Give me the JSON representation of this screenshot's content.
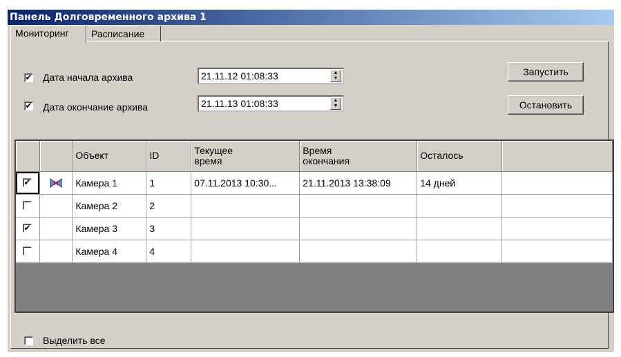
{
  "window": {
    "title": "Панель Долговременного архива 1"
  },
  "tabs": [
    {
      "label": "Мониторинг",
      "active": true
    },
    {
      "label": "Расписание",
      "active": false
    }
  ],
  "archive_start": {
    "label": "Дата начала архива",
    "checked": true,
    "value": "21.11.12 01:08:33"
  },
  "archive_end": {
    "label": "Дата окончание архива",
    "checked": true,
    "value": "21.11.13 01:08:33"
  },
  "buttons": {
    "start": "Запустить",
    "stop": "Остановить"
  },
  "table": {
    "columns": [
      "",
      "",
      "Объект",
      "ID",
      "Текущее время",
      "Время окончания",
      "Осталось",
      ""
    ],
    "rows": [
      {
        "checked": true,
        "icon": "camera-recording-icon",
        "object": "Камера 1",
        "id": "1",
        "current_time": "07.11.2013 10:30...",
        "end_time": "21.11.2013 13:38:09",
        "remaining": "14 дней"
      },
      {
        "checked": false,
        "icon": "",
        "object": "Камера 2",
        "id": "2",
        "current_time": "",
        "end_time": "",
        "remaining": ""
      },
      {
        "checked": true,
        "icon": "",
        "object": "Камера 3",
        "id": "3",
        "current_time": "",
        "end_time": "",
        "remaining": ""
      },
      {
        "checked": false,
        "icon": "",
        "object": "Камера 4",
        "id": "4",
        "current_time": "",
        "end_time": "",
        "remaining": ""
      }
    ]
  },
  "select_all": {
    "label": "Выделить все",
    "checked": false
  },
  "colors": {
    "title_start": "#0a246a",
    "title_end": "#a6caf0",
    "face": "#d4d0c8",
    "grid_empty": "#808080"
  }
}
